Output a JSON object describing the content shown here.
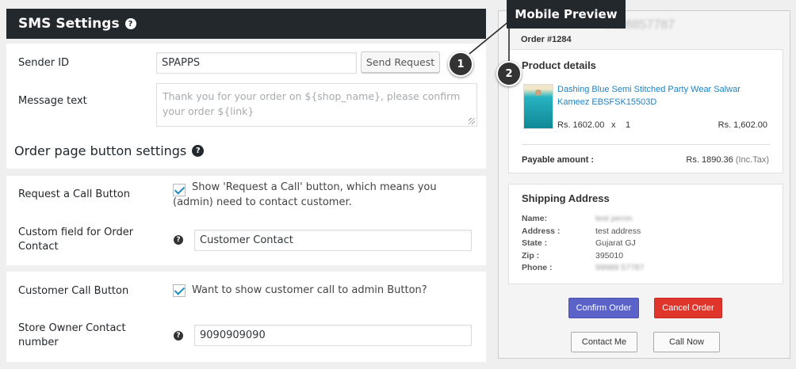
{
  "sms_settings": {
    "title": "SMS Settings",
    "sender_id_label": "Sender ID",
    "sender_id_value": "SPAPPS",
    "send_request_label": "Send Request",
    "message_label": "Message text",
    "message_placeholder": "Thank you for your order on ${shop_name}, please confirm your order ${link}"
  },
  "order_page": {
    "title": "Order page button settings",
    "request_call_label": "Request a Call Button",
    "request_call_checkbox_text": "Show 'Request a Call' button, which means you (admin) need to contact customer.",
    "custom_field_label": "Custom field for Order Contact",
    "custom_field_value": "Customer Contact",
    "customer_call_label": "Customer Call Button",
    "customer_call_checkbox_text": "Want to show customer call to admin Button?",
    "store_owner_label": "Store Owner Contact number",
    "store_owner_value": "9090909090"
  },
  "callouts": [
    "1",
    "2"
  ],
  "preview": {
    "tab_label": "Mobile Preview",
    "order_number": "Order #1284",
    "phone_blurred": "9998857787",
    "product_details_title": "Product details",
    "product_name": "Dashing Blue Semi Stitched Party Wear Salwar Kameez EBSFSK15503D",
    "price": "Rs. 1602.00",
    "times": "x",
    "qty": "1",
    "line_total": "Rs. 1,602.00",
    "payable_label": "Payable amount :",
    "payable_value": "Rs. 1890.36",
    "payable_note": "(Inc.Tax)",
    "shipping_title": "Shipping Address",
    "shipping": [
      {
        "label": "Name:",
        "value": "test peron",
        "blurred": true
      },
      {
        "label": "Address :",
        "value": "test address",
        "blurred": false
      },
      {
        "label": "State :",
        "value": "Gujarat GJ",
        "blurred": false
      },
      {
        "label": "Zip :",
        "value": "395010",
        "blurred": false
      },
      {
        "label": "Phone :",
        "value": "99989 57787",
        "blurred": true
      }
    ],
    "confirm_label": "Confirm Order",
    "cancel_label": "Cancel Order",
    "contact_label": "Contact Me",
    "call_label": "Call Now"
  }
}
